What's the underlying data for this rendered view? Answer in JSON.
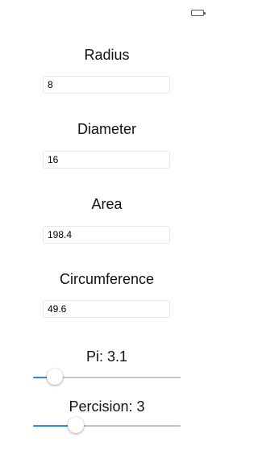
{
  "status_bar": {
    "battery_icon": "battery-icon"
  },
  "radius": {
    "label": "Radius",
    "value": "8"
  },
  "diameter": {
    "label": "Diameter",
    "value": "16"
  },
  "area": {
    "label": "Area",
    "value": "198.4"
  },
  "circumference": {
    "label": "Circumference",
    "value": "49.6"
  },
  "pi": {
    "label": "Pi: 3.1",
    "slider_fraction": 0.15
  },
  "precision": {
    "label": "Percision: 3",
    "slider_fraction": 0.29
  },
  "colors": {
    "slider_fill": "#2f86ee",
    "slider_track": "#c6c6c8"
  }
}
